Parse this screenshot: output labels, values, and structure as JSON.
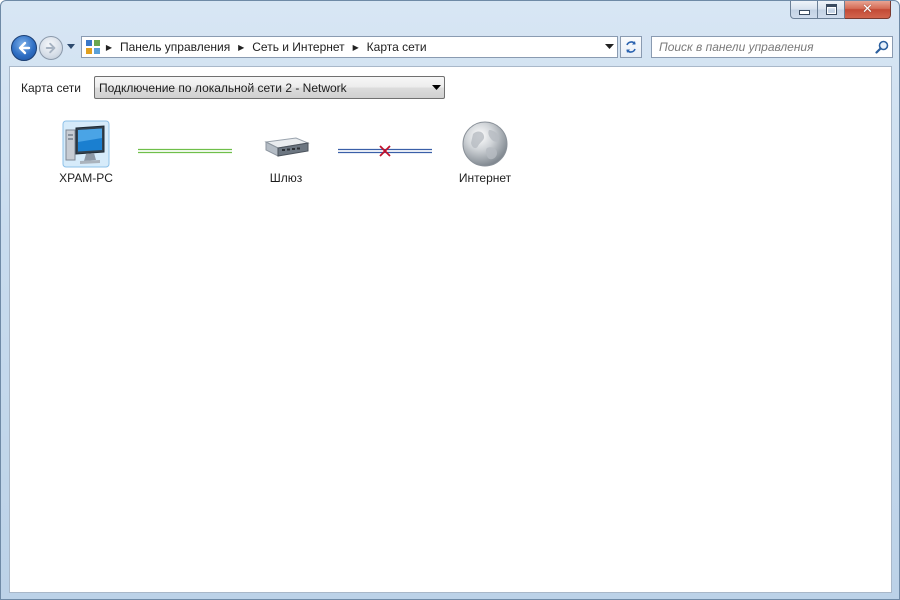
{
  "window": {
    "close_glyph": "✕"
  },
  "address_bar": {
    "icon": "control-panel-icon",
    "breadcrumbs": [
      "Панель управления",
      "Сеть и Интернет",
      "Карта сети"
    ]
  },
  "search": {
    "placeholder": "Поиск в панели управления"
  },
  "map": {
    "label": "Карта сети",
    "connection_selected": "Подключение по локальной сети 2 - Network",
    "nodes": [
      {
        "label": "XPAM-PC",
        "icon": "computer-icon"
      },
      {
        "label": "Шлюз",
        "icon": "gateway-router-icon"
      },
      {
        "label": "Интернет",
        "icon": "globe-icon"
      }
    ],
    "links": [
      {
        "status": "connected",
        "color": "#6fbf4a"
      },
      {
        "status": "disconnected",
        "color": "#3a5fa8",
        "mark_color": "#c0102a"
      }
    ]
  }
}
